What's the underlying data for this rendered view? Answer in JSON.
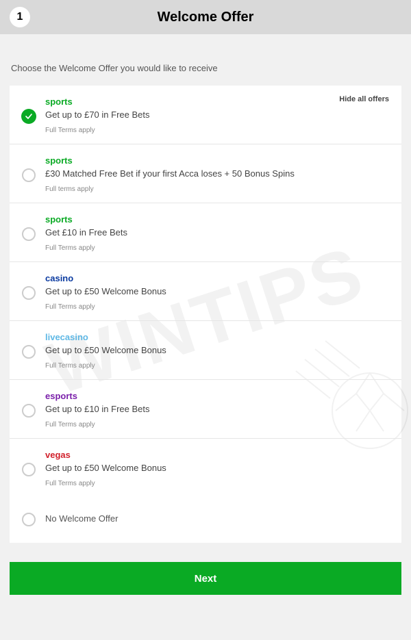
{
  "header": {
    "step": "1",
    "title": "Welcome Offer"
  },
  "instruction": "Choose the Welcome Offer you would like to receive",
  "hide_all": "Hide all offers",
  "offers": [
    {
      "category": "sports",
      "catClass": "c-sports",
      "desc": "Get up to £70 in Free Bets",
      "terms": "Full Terms apply",
      "selected": true
    },
    {
      "category": "sports",
      "catClass": "c-sports",
      "desc": "£30 Matched Free Bet if your first Acca loses + 50 Bonus Spins",
      "terms": "Full terms apply",
      "selected": false
    },
    {
      "category": "sports",
      "catClass": "c-sports",
      "desc": "Get £10 in Free Bets",
      "terms": "Full Terms apply",
      "selected": false
    },
    {
      "category": "casino",
      "catClass": "c-casino",
      "desc": "Get up to £50 Welcome Bonus",
      "terms": "Full Terms apply",
      "selected": false
    },
    {
      "category": "livecasino",
      "catClass": "c-livecasino",
      "desc": "Get up to £50 Welcome Bonus",
      "terms": "Full Terms apply",
      "selected": false
    },
    {
      "category": "esports",
      "catClass": "c-esports",
      "desc": "Get up to £10 in Free Bets",
      "terms": "Full Terms apply",
      "selected": false
    },
    {
      "category": "vegas",
      "catClass": "c-vegas",
      "desc": "Get up to £50 Welcome Bonus",
      "terms": "Full Terms apply",
      "selected": false
    }
  ],
  "no_offer_label": "No Welcome Offer",
  "next_label": "Next",
  "watermark": "WINTIPS"
}
